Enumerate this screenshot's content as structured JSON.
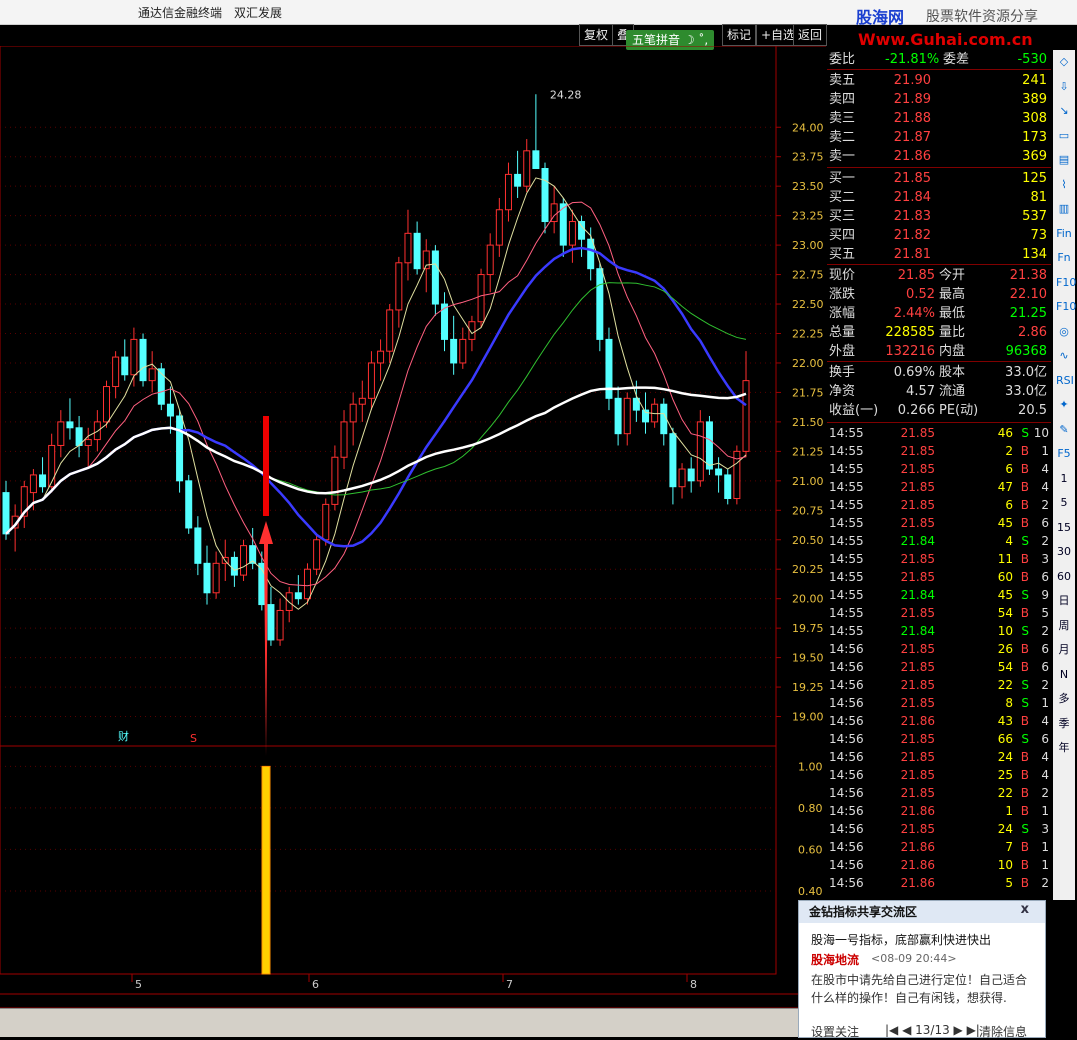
{
  "window": {
    "title_left": "通达信金融终端",
    "stock_name": "双汇发展",
    "logo_main": "股海网",
    "logo_sub": "股票软件资源分享",
    "logo_url": "Www.Guhai.com.cn"
  },
  "toolbar": {
    "items": [
      "复权",
      "叠",
      "",
      "标记",
      "+自选",
      "返回"
    ]
  },
  "ime": {
    "label": "五笔拼音"
  },
  "chart_data": {
    "type": "candlestick",
    "price_axis": {
      "ticks": [
        24.0,
        23.75,
        23.5,
        23.25,
        23.0,
        22.75,
        22.5,
        22.25,
        22.0,
        21.75,
        21.5,
        21.25,
        21.0,
        20.75,
        20.5,
        20.25,
        20.0,
        19.75,
        19.5,
        19.25,
        19.0
      ],
      "range": [
        18.75,
        24.35
      ]
    },
    "indicator_axis": {
      "ticks": [
        1.0,
        0.8,
        0.6,
        0.4
      ],
      "range": [
        0,
        1.05
      ]
    },
    "max_label": "24.28",
    "date_labels": [
      "5",
      "6",
      "7",
      "8"
    ],
    "markers": [
      "财",
      "S"
    ],
    "candles": [
      {
        "o": 20.9,
        "h": 21.0,
        "l": 20.5,
        "c": 20.55
      },
      {
        "o": 20.6,
        "h": 20.8,
        "l": 20.4,
        "c": 20.7
      },
      {
        "o": 20.7,
        "h": 21.0,
        "l": 20.6,
        "c": 20.95
      },
      {
        "o": 20.9,
        "h": 21.1,
        "l": 20.75,
        "c": 21.05
      },
      {
        "o": 21.05,
        "h": 21.2,
        "l": 20.9,
        "c": 20.95
      },
      {
        "o": 20.95,
        "h": 21.4,
        "l": 20.9,
        "c": 21.3
      },
      {
        "o": 21.3,
        "h": 21.6,
        "l": 21.2,
        "c": 21.5
      },
      {
        "o": 21.5,
        "h": 21.7,
        "l": 21.35,
        "c": 21.45
      },
      {
        "o": 21.45,
        "h": 21.55,
        "l": 21.2,
        "c": 21.3
      },
      {
        "o": 21.3,
        "h": 21.45,
        "l": 21.1,
        "c": 21.35
      },
      {
        "o": 21.35,
        "h": 21.6,
        "l": 21.25,
        "c": 21.5
      },
      {
        "o": 21.5,
        "h": 21.85,
        "l": 21.45,
        "c": 21.8
      },
      {
        "o": 21.8,
        "h": 22.1,
        "l": 21.7,
        "c": 22.05
      },
      {
        "o": 22.05,
        "h": 22.2,
        "l": 21.85,
        "c": 21.9
      },
      {
        "o": 21.9,
        "h": 22.3,
        "l": 21.8,
        "c": 22.2
      },
      {
        "o": 22.2,
        "h": 22.25,
        "l": 21.8,
        "c": 21.85
      },
      {
        "o": 21.85,
        "h": 22.1,
        "l": 21.75,
        "c": 21.95
      },
      {
        "o": 21.95,
        "h": 22.0,
        "l": 21.6,
        "c": 21.65
      },
      {
        "o": 21.65,
        "h": 21.8,
        "l": 21.4,
        "c": 21.55
      },
      {
        "o": 21.55,
        "h": 21.6,
        "l": 20.9,
        "c": 21.0
      },
      {
        "o": 21.0,
        "h": 21.05,
        "l": 20.55,
        "c": 20.6
      },
      {
        "o": 20.6,
        "h": 20.7,
        "l": 20.2,
        "c": 20.3
      },
      {
        "o": 20.3,
        "h": 20.45,
        "l": 19.95,
        "c": 20.05
      },
      {
        "o": 20.05,
        "h": 20.4,
        "l": 20.0,
        "c": 20.3
      },
      {
        "o": 20.3,
        "h": 20.5,
        "l": 20.15,
        "c": 20.35
      },
      {
        "o": 20.35,
        "h": 20.4,
        "l": 20.1,
        "c": 20.2
      },
      {
        "o": 20.2,
        "h": 20.5,
        "l": 20.15,
        "c": 20.45
      },
      {
        "o": 20.45,
        "h": 20.6,
        "l": 20.25,
        "c": 20.3
      },
      {
        "o": 20.3,
        "h": 20.4,
        "l": 19.9,
        "c": 19.95
      },
      {
        "o": 19.95,
        "h": 20.1,
        "l": 19.6,
        "c": 19.65
      },
      {
        "o": 19.65,
        "h": 20.0,
        "l": 19.6,
        "c": 19.9
      },
      {
        "o": 19.9,
        "h": 20.1,
        "l": 19.8,
        "c": 20.05
      },
      {
        "o": 20.05,
        "h": 20.2,
        "l": 19.95,
        "c": 20.0
      },
      {
        "o": 20.0,
        "h": 20.3,
        "l": 19.95,
        "c": 20.25
      },
      {
        "o": 20.25,
        "h": 20.55,
        "l": 20.2,
        "c": 20.5
      },
      {
        "o": 20.5,
        "h": 20.85,
        "l": 20.45,
        "c": 20.8
      },
      {
        "o": 20.8,
        "h": 21.3,
        "l": 20.75,
        "c": 21.2
      },
      {
        "o": 21.2,
        "h": 21.6,
        "l": 21.1,
        "c": 21.5
      },
      {
        "o": 21.5,
        "h": 21.75,
        "l": 21.3,
        "c": 21.65
      },
      {
        "o": 21.65,
        "h": 21.85,
        "l": 21.5,
        "c": 21.7
      },
      {
        "o": 21.7,
        "h": 22.1,
        "l": 21.6,
        "c": 22.0
      },
      {
        "o": 22.0,
        "h": 22.2,
        "l": 21.85,
        "c": 22.1
      },
      {
        "o": 22.1,
        "h": 22.5,
        "l": 22.0,
        "c": 22.45
      },
      {
        "o": 22.45,
        "h": 22.9,
        "l": 22.3,
        "c": 22.85
      },
      {
        "o": 22.85,
        "h": 23.3,
        "l": 22.7,
        "c": 23.1
      },
      {
        "o": 23.1,
        "h": 23.2,
        "l": 22.75,
        "c": 22.8
      },
      {
        "o": 22.8,
        "h": 23.05,
        "l": 22.6,
        "c": 22.95
      },
      {
        "o": 22.95,
        "h": 23.0,
        "l": 22.4,
        "c": 22.5
      },
      {
        "o": 22.5,
        "h": 22.6,
        "l": 22.1,
        "c": 22.2
      },
      {
        "o": 22.2,
        "h": 22.4,
        "l": 21.9,
        "c": 22.0
      },
      {
        "o": 22.0,
        "h": 22.3,
        "l": 21.95,
        "c": 22.2
      },
      {
        "o": 22.2,
        "h": 22.4,
        "l": 22.1,
        "c": 22.35
      },
      {
        "o": 22.35,
        "h": 22.8,
        "l": 22.3,
        "c": 22.75
      },
      {
        "o": 22.75,
        "h": 23.1,
        "l": 22.6,
        "c": 23.0
      },
      {
        "o": 23.0,
        "h": 23.4,
        "l": 22.9,
        "c": 23.3
      },
      {
        "o": 23.3,
        "h": 23.7,
        "l": 23.2,
        "c": 23.6
      },
      {
        "o": 23.6,
        "h": 23.8,
        "l": 23.4,
        "c": 23.5
      },
      {
        "o": 23.5,
        "h": 23.9,
        "l": 23.45,
        "c": 23.8
      },
      {
        "o": 23.8,
        "h": 24.28,
        "l": 23.7,
        "c": 23.65
      },
      {
        "o": 23.65,
        "h": 23.7,
        "l": 23.1,
        "c": 23.2
      },
      {
        "o": 23.2,
        "h": 23.5,
        "l": 23.1,
        "c": 23.35
      },
      {
        "o": 23.35,
        "h": 23.4,
        "l": 22.9,
        "c": 23.0
      },
      {
        "o": 23.0,
        "h": 23.3,
        "l": 22.85,
        "c": 23.2
      },
      {
        "o": 23.2,
        "h": 23.25,
        "l": 22.9,
        "c": 23.05
      },
      {
        "o": 23.05,
        "h": 23.15,
        "l": 22.7,
        "c": 22.8
      },
      {
        "o": 22.8,
        "h": 22.85,
        "l": 22.1,
        "c": 22.2
      },
      {
        "o": 22.2,
        "h": 22.3,
        "l": 21.6,
        "c": 21.7
      },
      {
        "o": 21.7,
        "h": 21.8,
        "l": 21.3,
        "c": 21.4
      },
      {
        "o": 21.4,
        "h": 21.75,
        "l": 21.3,
        "c": 21.7
      },
      {
        "o": 21.7,
        "h": 21.85,
        "l": 21.5,
        "c": 21.6
      },
      {
        "o": 21.6,
        "h": 21.75,
        "l": 21.4,
        "c": 21.5
      },
      {
        "o": 21.5,
        "h": 21.7,
        "l": 21.45,
        "c": 21.65
      },
      {
        "o": 21.65,
        "h": 21.7,
        "l": 21.3,
        "c": 21.4
      },
      {
        "o": 21.4,
        "h": 21.45,
        "l": 20.8,
        "c": 20.95
      },
      {
        "o": 20.95,
        "h": 21.15,
        "l": 20.85,
        "c": 21.1
      },
      {
        "o": 21.1,
        "h": 21.2,
        "l": 20.9,
        "c": 21.0
      },
      {
        "o": 21.0,
        "h": 21.6,
        "l": 20.95,
        "c": 21.5
      },
      {
        "o": 21.5,
        "h": 21.55,
        "l": 21.05,
        "c": 21.1
      },
      {
        "o": 21.1,
        "h": 21.2,
        "l": 20.9,
        "c": 21.05
      },
      {
        "o": 21.05,
        "h": 21.1,
        "l": 20.8,
        "c": 20.85
      },
      {
        "o": 20.85,
        "h": 21.3,
        "l": 20.8,
        "c": 21.25
      },
      {
        "o": 21.25,
        "h": 22.1,
        "l": 21.2,
        "c": 21.85
      }
    ],
    "signal_bar": {
      "value": 1.0
    }
  },
  "quote": {
    "weibi_label": "委比",
    "weibi_value": "-21.81%",
    "weicha_label": "委差",
    "weicha_value": "-530",
    "asks": [
      {
        "label": "卖五",
        "price": "21.90",
        "vol": "241"
      },
      {
        "label": "卖四",
        "price": "21.89",
        "vol": "389"
      },
      {
        "label": "卖三",
        "price": "21.88",
        "vol": "308"
      },
      {
        "label": "卖二",
        "price": "21.87",
        "vol": "173"
      },
      {
        "label": "卖一",
        "price": "21.86",
        "vol": "369"
      }
    ],
    "bids": [
      {
        "label": "买一",
        "price": "21.85",
        "vol": "125"
      },
      {
        "label": "买二",
        "price": "21.84",
        "vol": "81"
      },
      {
        "label": "买三",
        "price": "21.83",
        "vol": "537"
      },
      {
        "label": "买四",
        "price": "21.82",
        "vol": "73"
      },
      {
        "label": "买五",
        "price": "21.81",
        "vol": "134"
      }
    ],
    "stats": [
      {
        "l1": "现价",
        "v1": "21.85",
        "c1": "#ff4040",
        "l2": "今开",
        "v2": "21.38",
        "c2": "#ff4040"
      },
      {
        "l1": "涨跌",
        "v1": "0.52",
        "c1": "#ff4040",
        "l2": "最高",
        "v2": "22.10",
        "c2": "#ff4040"
      },
      {
        "l1": "涨幅",
        "v1": "2.44%",
        "c1": "#ff4040",
        "l2": "最低",
        "v2": "21.25",
        "c2": "#00ff00"
      },
      {
        "l1": "总量",
        "v1": "228585",
        "c1": "#ffff00",
        "l2": "量比",
        "v2": "2.86",
        "c2": "#ff4040"
      },
      {
        "l1": "外盘",
        "v1": "132216",
        "c1": "#ff4040",
        "l2": "内盘",
        "v2": "96368",
        "c2": "#00ff00"
      }
    ],
    "stats2": [
      {
        "l1": "换手",
        "v1": "0.69%",
        "l2": "股本",
        "v2": "33.0亿"
      },
      {
        "l1": "净资",
        "v1": "4.57",
        "l2": "流通",
        "v2": "33.0亿"
      },
      {
        "l1": "收益(一)",
        "v1": "0.266",
        "l2": "PE(动)",
        "v2": "20.5"
      }
    ],
    "ticks": [
      {
        "t": "14:55",
        "p": "21.85",
        "v": "46",
        "s": "S",
        "n": "10"
      },
      {
        "t": "14:55",
        "p": "21.85",
        "v": "2",
        "s": "B",
        "n": "1"
      },
      {
        "t": "14:55",
        "p": "21.85",
        "v": "6",
        "s": "B",
        "n": "4"
      },
      {
        "t": "14:55",
        "p": "21.85",
        "v": "47",
        "s": "B",
        "n": "4"
      },
      {
        "t": "14:55",
        "p": "21.85",
        "v": "6",
        "s": "B",
        "n": "2"
      },
      {
        "t": "14:55",
        "p": "21.85",
        "v": "45",
        "s": "B",
        "n": "6"
      },
      {
        "t": "14:55",
        "p": "21.84",
        "v": "4",
        "s": "S",
        "n": "2"
      },
      {
        "t": "14:55",
        "p": "21.85",
        "v": "11",
        "s": "B",
        "n": "3"
      },
      {
        "t": "14:55",
        "p": "21.85",
        "v": "60",
        "s": "B",
        "n": "6"
      },
      {
        "t": "14:55",
        "p": "21.84",
        "v": "45",
        "s": "S",
        "n": "9"
      },
      {
        "t": "14:55",
        "p": "21.85",
        "v": "54",
        "s": "B",
        "n": "5"
      },
      {
        "t": "14:55",
        "p": "21.84",
        "v": "10",
        "s": "S",
        "n": "2"
      },
      {
        "t": "14:56",
        "p": "21.85",
        "v": "26",
        "s": "B",
        "n": "6"
      },
      {
        "t": "14:56",
        "p": "21.85",
        "v": "54",
        "s": "B",
        "n": "6"
      },
      {
        "t": "14:56",
        "p": "21.85",
        "v": "22",
        "s": "S",
        "n": "2"
      },
      {
        "t": "14:56",
        "p": "21.85",
        "v": "8",
        "s": "S",
        "n": "1"
      },
      {
        "t": "14:56",
        "p": "21.86",
        "v": "43",
        "s": "B",
        "n": "4"
      },
      {
        "t": "14:56",
        "p": "21.85",
        "v": "66",
        "s": "S",
        "n": "6"
      },
      {
        "t": "14:56",
        "p": "21.85",
        "v": "24",
        "s": "B",
        "n": "4"
      },
      {
        "t": "14:56",
        "p": "21.85",
        "v": "25",
        "s": "B",
        "n": "4"
      },
      {
        "t": "14:56",
        "p": "21.85",
        "v": "22",
        "s": "B",
        "n": "2"
      },
      {
        "t": "14:56",
        "p": "21.86",
        "v": "1",
        "s": "B",
        "n": "1"
      },
      {
        "t": "14:56",
        "p": "21.85",
        "v": "24",
        "s": "S",
        "n": "3"
      },
      {
        "t": "14:56",
        "p": "21.86",
        "v": "7",
        "s": "B",
        "n": "1"
      },
      {
        "t": "14:56",
        "p": "21.86",
        "v": "10",
        "s": "B",
        "n": "1"
      },
      {
        "t": "14:56",
        "p": "21.86",
        "v": "5",
        "s": "B",
        "n": "2"
      }
    ]
  },
  "sidetools": [
    "日",
    "周",
    "月",
    "N",
    "多",
    "季",
    "年",
    "1",
    "5",
    "15",
    "30",
    "60"
  ],
  "popup": {
    "title": "金钻指标共享交流区",
    "close": "x",
    "line1": "股海一号指标，底部赢利快进快出",
    "author": "股海地流",
    "date": "<08-09 20:44>",
    "body": "在股市中请先给自己进行定位！自己适合什么样的操作！自己有闲钱，想获得.",
    "settings": "设置关注",
    "nav": "|◀ ◀ 13/13 ▶ ▶|",
    "clear": "清除信息"
  },
  "colors": {
    "up": "#ff3030",
    "down": "#54ffff",
    "axis": "#a00000",
    "bg": "#000000"
  }
}
